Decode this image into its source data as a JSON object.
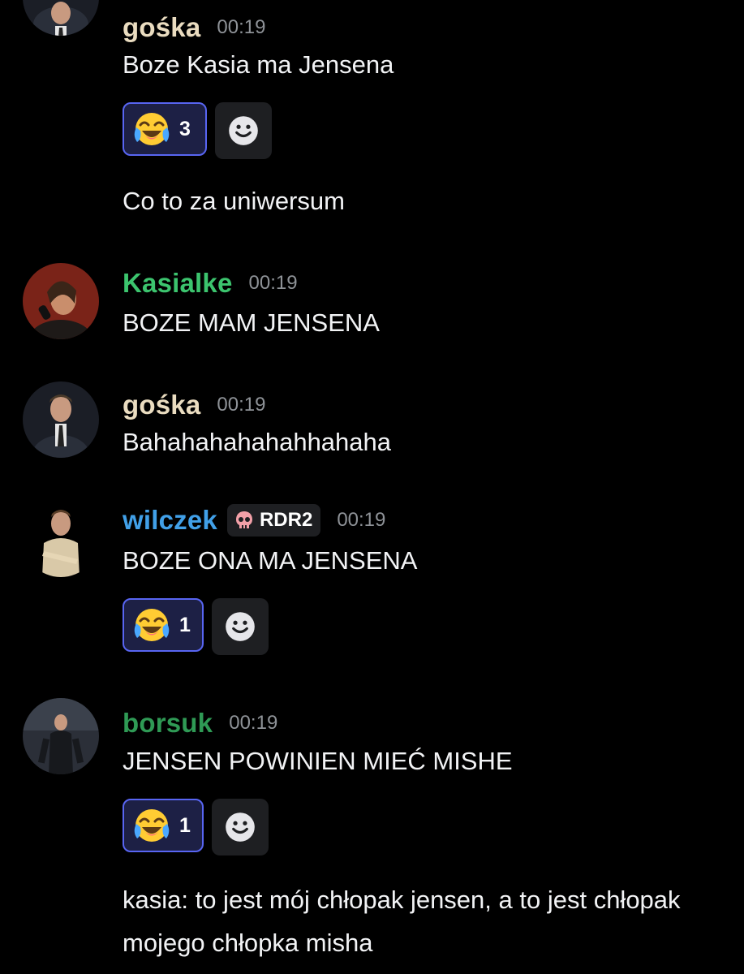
{
  "colors": {
    "background": "#000000",
    "name_goska": "#eadcc0",
    "name_kasialke": "#3cc46e",
    "name_wilczek": "#41a0e8",
    "name_borsuk": "#2f9a55",
    "timestamp": "#8e9297",
    "reaction_border": "#5865f2"
  },
  "messages": [
    {
      "author": "gośka",
      "time": "00:19",
      "lines": [
        "Boze Kasia ma Jensena",
        "Co to za uniwersum"
      ],
      "reaction": {
        "emoji": "joy-emoji-icon",
        "count": "3"
      }
    },
    {
      "author": "Kasialke",
      "time": "00:19",
      "lines": [
        "BOZE MAM JENSENA"
      ]
    },
    {
      "author": "gośka",
      "time": "00:19",
      "lines": [
        "Bahahahahahahhahaha"
      ]
    },
    {
      "author": "wilczek",
      "tag": "RDR2",
      "time": "00:19",
      "lines": [
        "BOZE ONA MA JENSENA"
      ],
      "reaction": {
        "emoji": "joy-emoji-icon",
        "count": "1"
      }
    },
    {
      "author": "borsuk",
      "time": "00:19",
      "lines": [
        "JENSEN POWINIEN MIEĆ MISHE",
        "kasia: to jest mój chłopak jensen, a to jest chłopak mojego chłopka misha"
      ],
      "reaction": {
        "emoji": "joy-emoji-icon",
        "count": "1"
      }
    }
  ]
}
